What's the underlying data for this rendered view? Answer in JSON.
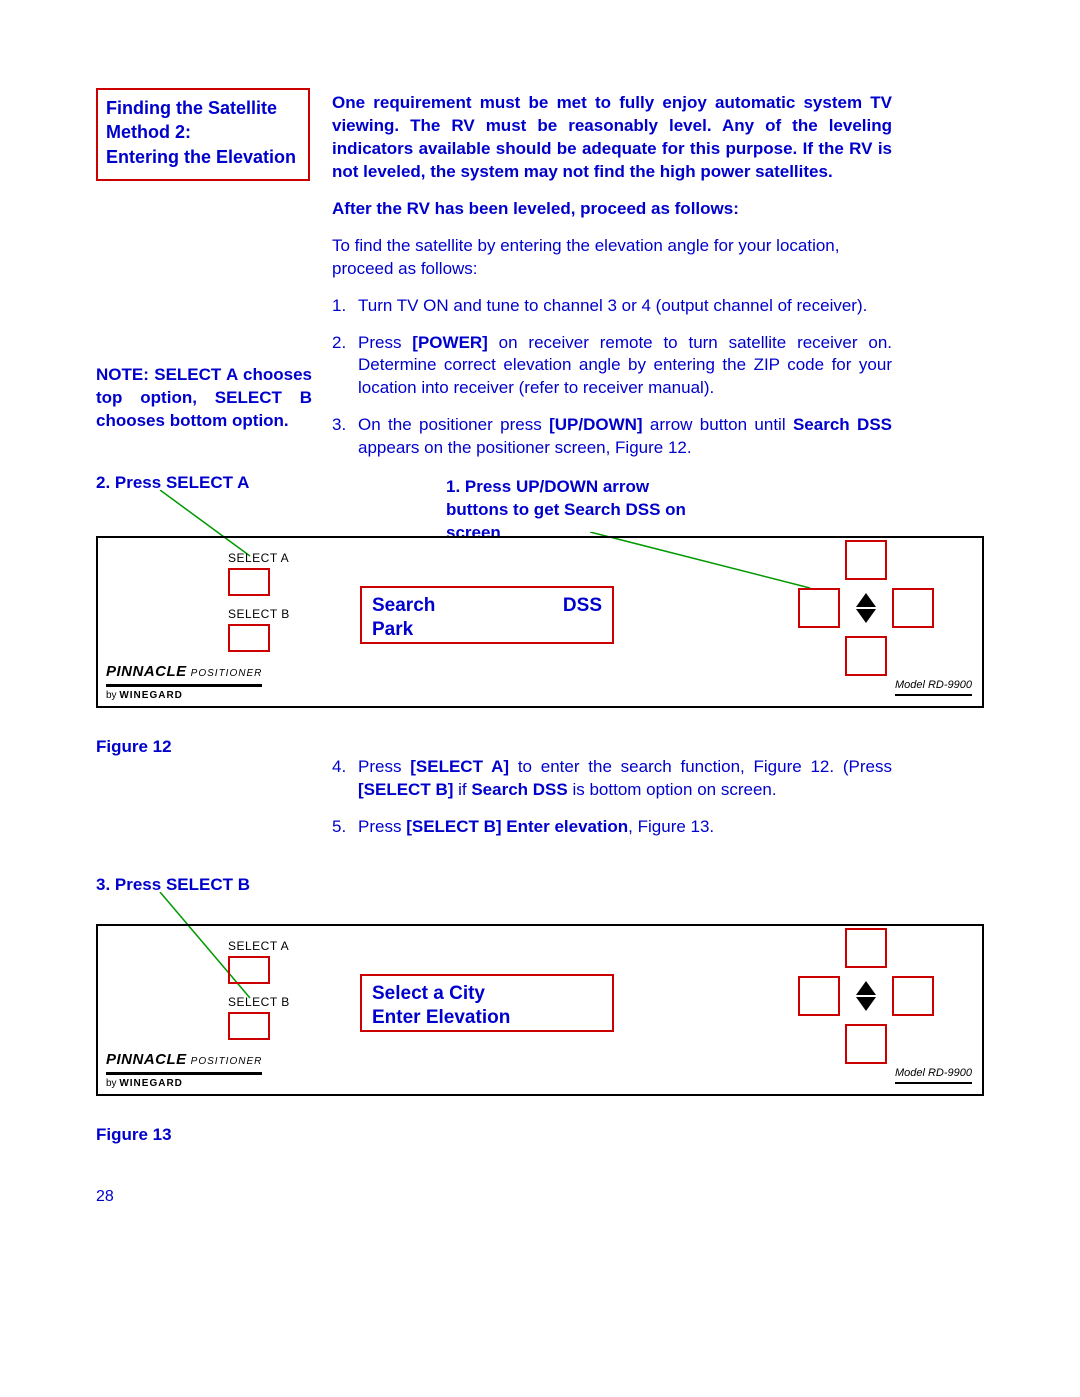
{
  "title": {
    "line1": "Finding the Satellite",
    "line2": "Method 2:",
    "line3": "Entering the Elevation"
  },
  "intro_block": {
    "p1": "One requirement must be met to fully enjoy automatic system TV viewing. The RV must be reasonably level.  Any of the leveling indicators available should be adequate for this purpose.  If the RV is not leveled, the system may not find the high power satellites.",
    "p2": "After the RV has been leveled, proceed as follows:"
  },
  "para_lead": "To find the satellite by entering the elevation angle for your location, proceed as follows:",
  "steps": {
    "s1": "Turn TV ON and tune to channel 3 or 4 (output channel of receiver).",
    "s2_a": "Press ",
    "s2_b": "[POWER]",
    "s2_c": " on receiver remote to turn satellite receiver on. Determine correct elevation angle by entering the ZIP code for your location into receiver (refer to receiver manual).",
    "s3_a": "On the positioner press ",
    "s3_b": "[UP/DOWN]",
    "s3_c": " arrow button until ",
    "s3_d": "Search   DSS",
    "s3_e": " appears on the positioner screen, Figure 12.",
    "s4_a": "Press ",
    "s4_b": "[SELECT A]",
    "s4_c": " to enter the search function, Figure 12.  (Press ",
    "s4_d": "[SELECT B]",
    "s4_e": " if ",
    "s4_f": "Search  DSS",
    "s4_g": " is bottom option on screen.",
    "s5_a": "Press ",
    "s5_b": "[SELECT B] Enter elevation",
    "s5_c": ", Figure 13."
  },
  "note": "NOTE:  SELECT A chooses top option, SELECT B chooses bottom option.",
  "callouts": {
    "a": "2. Press SELECT A",
    "arrow": "1.   Press UP/DOWN arrow buttons to get Search  DSS on screen",
    "b": "3. Press SELECT B"
  },
  "device": {
    "selectA": "SELECT A",
    "selectB": "SELECT B",
    "brand_main": "PINNACLE",
    "brand_sub": "POSITIONER",
    "byline_pre": "by ",
    "byline_brand": "WINEGARD",
    "model": "Model RD-9900"
  },
  "screen1": {
    "top_left": "Search",
    "top_right": "DSS",
    "bottom": "Park"
  },
  "screen2": {
    "line1": "Select a City",
    "line2": "Enter Elevation"
  },
  "labels": {
    "fig12": "Figure 12",
    "fig13": "Figure 13"
  },
  "page_number": "28"
}
